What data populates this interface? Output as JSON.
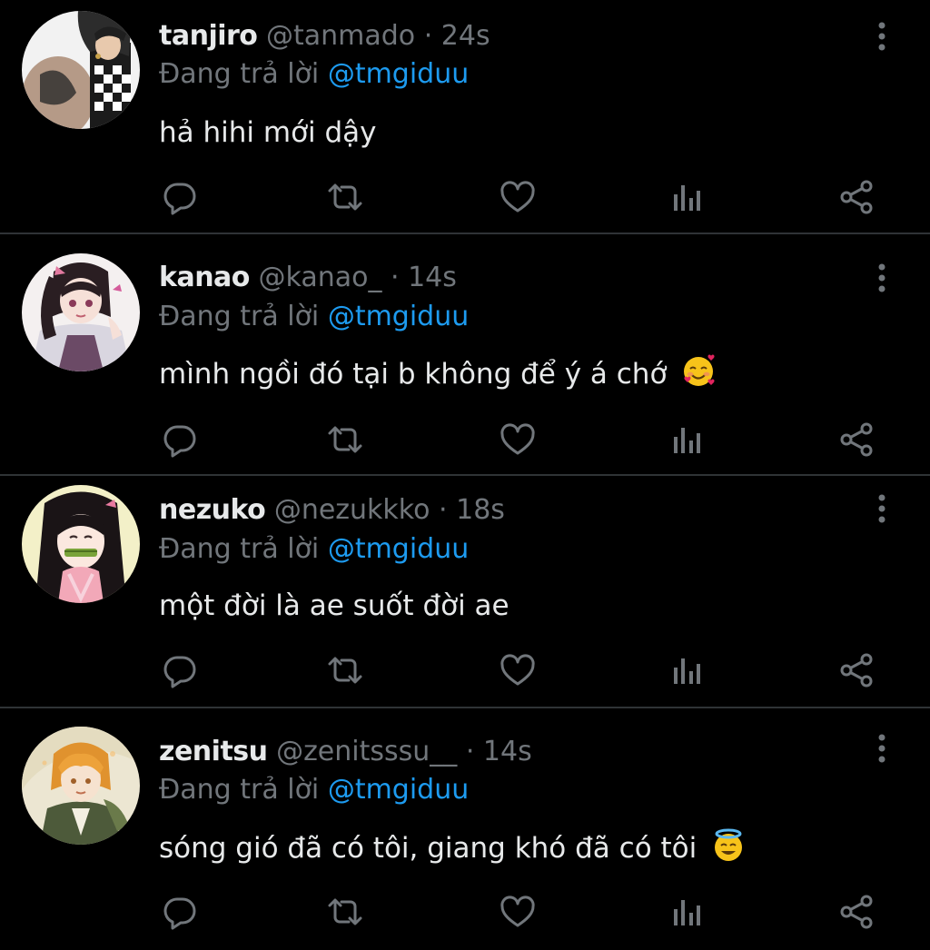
{
  "colors": {
    "background": "#000000",
    "text": "#e7e9ea",
    "muted": "#71767b",
    "accent": "#1d9bf0",
    "divider": "#2f3336"
  },
  "tweets": [
    {
      "name": "tanjiro",
      "handle": "@tanmado",
      "dot": "·",
      "time": "24s",
      "reply_prefix": "Đang trả lời",
      "reply_handle": "@tmgiduu",
      "text": "hả hihi mới dậy",
      "emoji": "",
      "avatar": "tanjiro-avatar"
    },
    {
      "name": "kanao",
      "handle": "@kanao_",
      "dot": "·",
      "time": "14s",
      "reply_prefix": "Đang trả lời",
      "reply_handle": "@tmgiduu",
      "text": "mình ngồi đó tại b không để ý á chớ",
      "emoji": "smiling-face-with-hearts",
      "avatar": "kanao-avatar"
    },
    {
      "name": "nezuko",
      "handle": "@nezukkko",
      "dot": "·",
      "time": "18s",
      "reply_prefix": "Đang trả lời",
      "reply_handle": "@tmgiduu",
      "text": "một đời là ae suốt đời ae",
      "emoji": "",
      "avatar": "nezuko-avatar"
    },
    {
      "name": "zenitsu",
      "handle": "@zenitsssu__",
      "dot": "·",
      "time": "14s",
      "reply_prefix": "Đang trả lời",
      "reply_handle": "@tmgiduu",
      "text": "sóng gió đã có tôi, giang khó đã có tôi",
      "emoji": "smiling-face-with-halo",
      "avatar": "zenitsu-avatar"
    }
  ],
  "action_icons": [
    "reply-icon",
    "retweet-icon",
    "like-icon",
    "analytics-icon",
    "share-icon"
  ]
}
